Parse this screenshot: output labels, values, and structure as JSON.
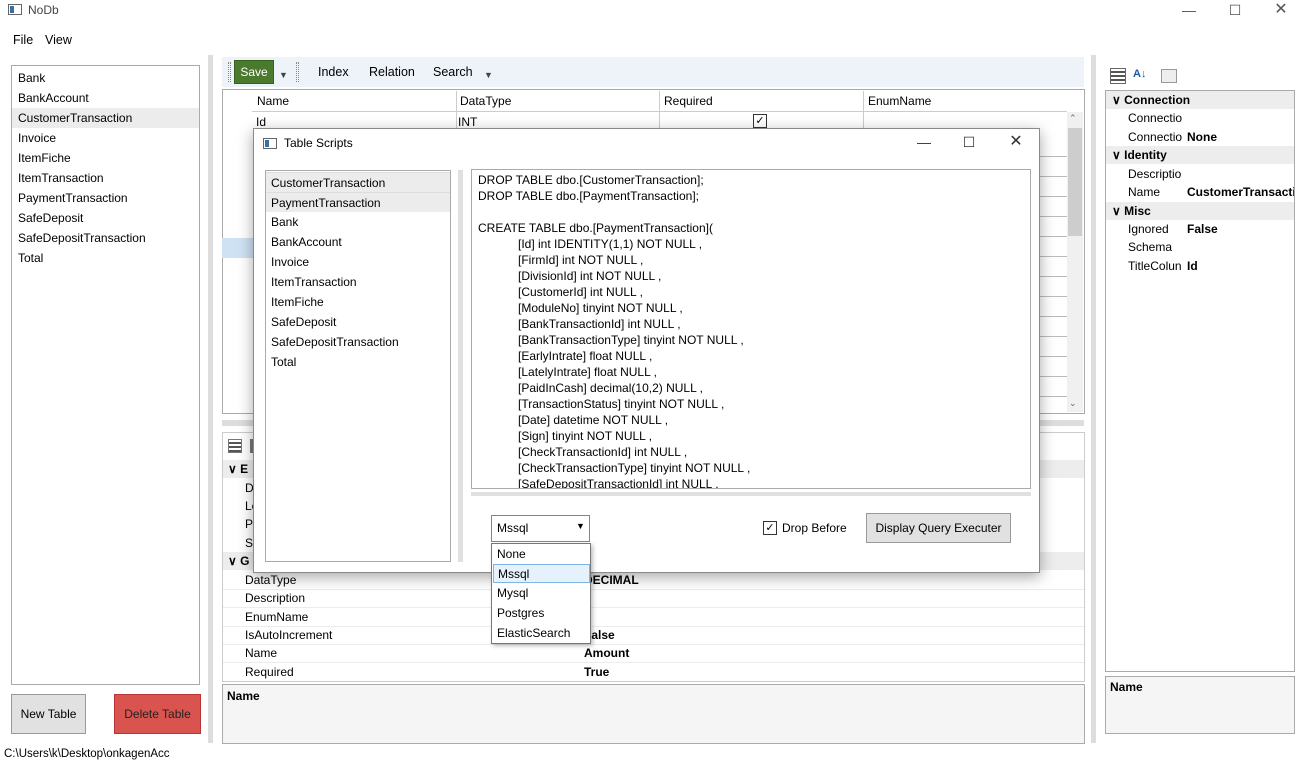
{
  "window": {
    "title": "NoDb"
  },
  "menu": {
    "file": "File",
    "view": "View"
  },
  "tables": [
    "Bank",
    "BankAccount",
    "CustomerTransaction",
    "Invoice",
    "ItemFiche",
    "ItemTransaction",
    "PaymentTransaction",
    "SafeDeposit",
    "SafeDepositTransaction",
    "Total"
  ],
  "selected_table": "CustomerTransaction",
  "buttons": {
    "new_table": "New Table",
    "delete_table": "Delete Table"
  },
  "toolbar": {
    "save": "Save",
    "index": "Index",
    "relation": "Relation",
    "search": "Search"
  },
  "grid": {
    "headers": [
      "Name",
      "DataType",
      "Required",
      "EnumName"
    ],
    "row1": {
      "name": "Id",
      "datatype": "INT",
      "required": true
    }
  },
  "prop_grid": {
    "cat1_partial": "E",
    "cat2_partial": "G",
    "truncated_names": [
      "D",
      "Le",
      "Pr",
      "Sc"
    ],
    "rows": [
      {
        "name": "DataType",
        "value": "DECIMAL"
      },
      {
        "name": "Description",
        "value": ""
      },
      {
        "name": "EnumName",
        "value": ""
      },
      {
        "name": "IsAutoIncrement",
        "value": "False"
      },
      {
        "name": "Name",
        "value": "Amount"
      },
      {
        "name": "Required",
        "value": "True"
      }
    ],
    "desc_title": "Name"
  },
  "right_props": {
    "categories": [
      {
        "label": "Connection",
        "rows": [
          {
            "name": "Connectio",
            "value": ""
          },
          {
            "name": "Connectio",
            "value": "None"
          }
        ]
      },
      {
        "label": "Identity",
        "rows": [
          {
            "name": "Descriptio",
            "value": ""
          },
          {
            "name": "Name",
            "value": "CustomerTransaction"
          }
        ]
      },
      {
        "label": "Misc",
        "rows": [
          {
            "name": "Ignored",
            "value": "False"
          },
          {
            "name": "Schema",
            "value": ""
          },
          {
            "name": "TitleColun",
            "value": "Id"
          }
        ]
      }
    ],
    "desc_title": "Name"
  },
  "status": "C:\\Users\\k\\Desktop\\onkagenAcc",
  "dialog": {
    "title": "Table Scripts",
    "tables": [
      "CustomerTransaction",
      "PaymentTransaction",
      "Bank",
      "BankAccount",
      "Invoice",
      "ItemTransaction",
      "ItemFiche",
      "SafeDeposit",
      "SafeDepositTransaction",
      "Total"
    ],
    "selected_table": "PaymentTransaction",
    "script": "DROP TABLE dbo.[CustomerTransaction];\nDROP TABLE dbo.[PaymentTransaction];\n\nCREATE TABLE dbo.[PaymentTransaction](\n            [Id] int IDENTITY(1,1) NOT NULL ,\n            [FirmId] int NOT NULL ,\n            [DivisionId] int NOT NULL ,\n            [CustomerId] int NULL ,\n            [ModuleNo] tinyint NOT NULL ,\n            [BankTransactionId] int NULL ,\n            [BankTransactionType] tinyint NOT NULL ,\n            [EarlyIntrate] float NULL ,\n            [LatelyIntrate] float NULL ,\n            [PaidInCash] decimal(10,2) NULL ,\n            [TransactionStatus] tinyint NOT NULL ,\n            [Date] datetime NOT NULL ,\n            [Sign] tinyint NOT NULL ,\n            [CheckTransactionId] int NULL ,\n            [CheckTransactionType] tinyint NOT NULL ,\n            [SafeDepositTransactionId] int NULL ,",
    "db_selected": "Mssql",
    "db_options": [
      "None",
      "Mssql",
      "Mysql",
      "Postgres",
      "ElasticSearch"
    ],
    "drop_before_label": "Drop Before",
    "drop_before_checked": true,
    "exec_button": "Display Query Executer"
  }
}
